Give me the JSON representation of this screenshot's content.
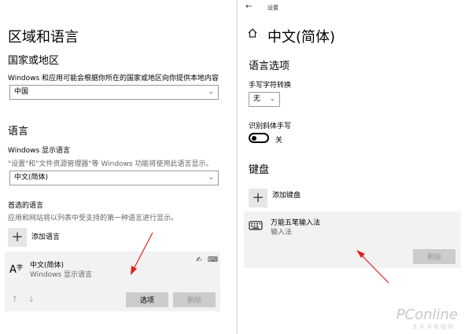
{
  "left": {
    "title": "区域和语言",
    "region": {
      "heading": "国家或地区",
      "description": "Windows 和应用可能会根据你所在的国家或地区向你提供本地内容",
      "value": "中国"
    },
    "language": {
      "heading": "语言",
      "display_label": "Windows 显示语言",
      "display_desc": "\"设置\"和\"文件资源管理器\"等 Windows 功能将使用此语言显示。",
      "display_value": "中文(简体)",
      "preferred_label": "首选的语言",
      "preferred_desc": "应用和网站将以列表中受支持的第一种语言进行显示。",
      "add_label": "添加语言",
      "item": {
        "name": "中文(简体)",
        "sub": "Windows 显示语言"
      },
      "options_button": "选项",
      "remove_button": "删除"
    }
  },
  "right": {
    "topbar_title": "设置",
    "title": "中文(简体)",
    "lang_options_heading": "语言选项",
    "handwriting_label": "手写字符转换",
    "handwriting_value": "无",
    "italic_label": "识别斜体手写",
    "italic_state": "关",
    "keyboard_heading": "键盘",
    "add_keyboard_label": "添加键盘",
    "ime": {
      "name": "万能五笔输入法",
      "sub": "输入法"
    },
    "remove_button": "删除"
  },
  "watermark": {
    "brand": "PConline",
    "sub": "太平洋电脑网"
  }
}
